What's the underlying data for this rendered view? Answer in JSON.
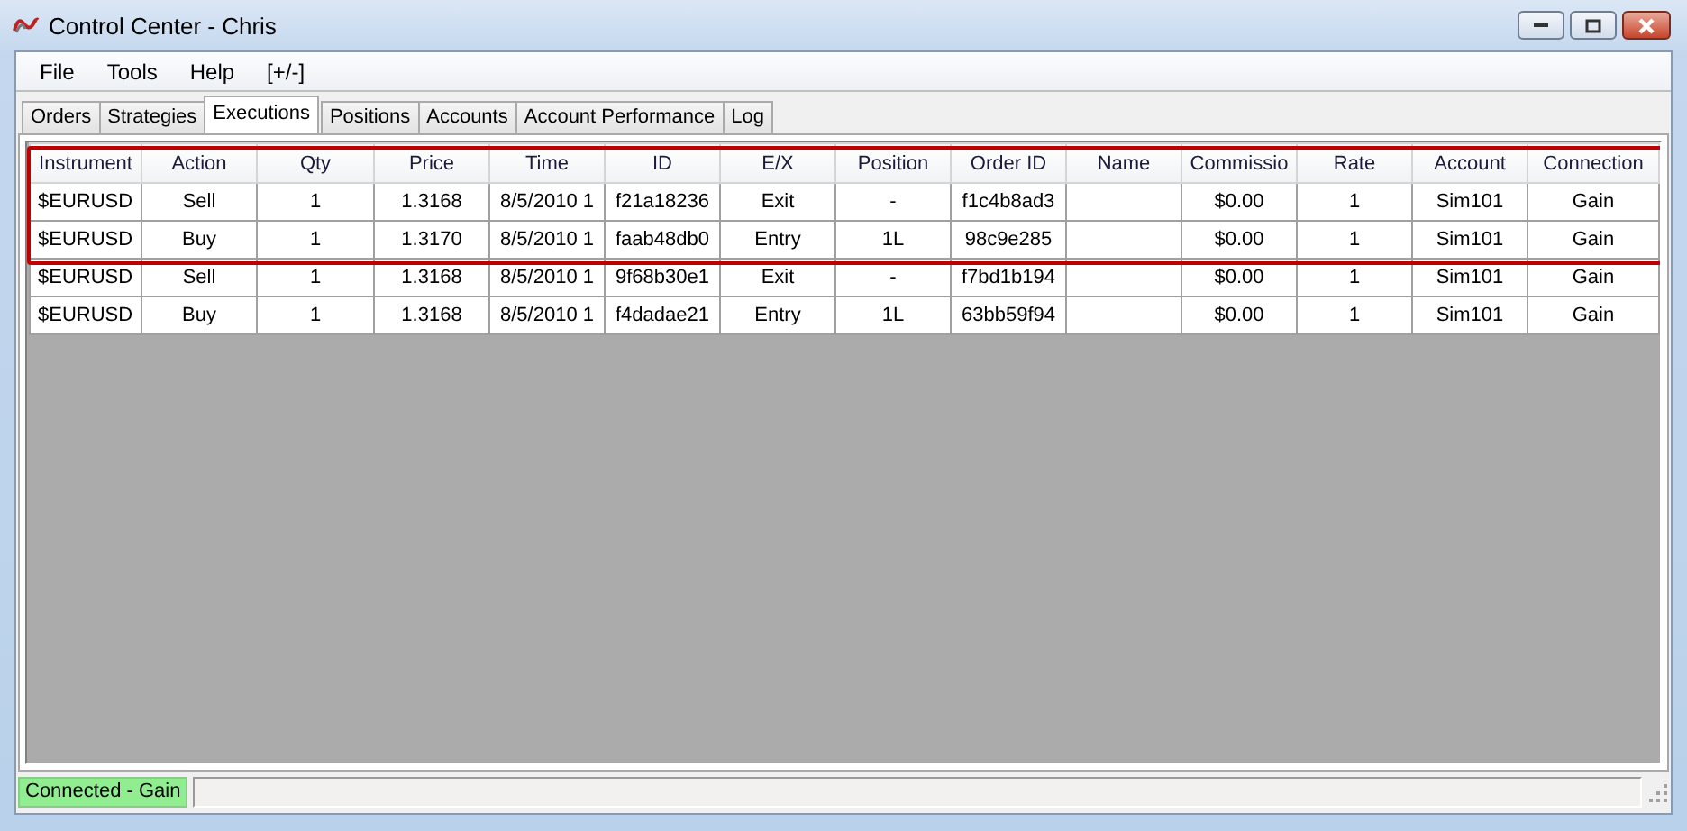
{
  "window": {
    "title": "Control Center - Chris"
  },
  "menu": [
    "File",
    "Tools",
    "Help",
    "[+/-]"
  ],
  "tabs": [
    {
      "label": "Orders",
      "selected": false
    },
    {
      "label": "Strategies",
      "selected": false
    },
    {
      "label": "Executions",
      "selected": true
    },
    {
      "label": "Positions",
      "selected": false
    },
    {
      "label": "Accounts",
      "selected": false
    },
    {
      "label": "Account Performance",
      "selected": false
    },
    {
      "label": "Log",
      "selected": false
    }
  ],
  "table": {
    "columns": [
      "Instrument",
      "Action",
      "Qty",
      "Price",
      "Time",
      "ID",
      "E/X",
      "Position",
      "Order ID",
      "Name",
      "Commissio",
      "Rate",
      "Account",
      "Connection"
    ],
    "rows": [
      {
        "highlighted": true,
        "instrument": "$EURUSD",
        "action": "Sell",
        "qty": "1",
        "price": "1.3168",
        "time": "8/5/2010 1",
        "id": "f21a18236",
        "ex": "Exit",
        "position": "-",
        "order_id": "f1c4b8ad3",
        "commission": "$0.00",
        "rate": "1",
        "account": "Sim101",
        "connection": "Gain"
      },
      {
        "highlighted": true,
        "instrument": "$EURUSD",
        "action": "Buy",
        "qty": "1",
        "price": "1.3170",
        "time": "8/5/2010 1",
        "id": "faab48db0",
        "ex": "Entry",
        "position": "1L",
        "order_id": "98c9e285",
        "commission": "$0.00",
        "rate": "1",
        "account": "Sim101",
        "connection": "Gain"
      },
      {
        "highlighted": false,
        "instrument": "$EURUSD",
        "action": "Sell",
        "qty": "1",
        "price": "1.3168",
        "time": "8/5/2010 1",
        "id": "9f68b30e1",
        "ex": "Exit",
        "position": "-",
        "order_id": "f7bd1b194",
        "commission": "$0.00",
        "rate": "1",
        "account": "Sim101",
        "connection": "Gain"
      },
      {
        "highlighted": false,
        "instrument": "$EURUSD",
        "action": "Buy",
        "qty": "1",
        "price": "1.3168",
        "time": "8/5/2010 1",
        "id": "f4dadae21",
        "ex": "Entry",
        "position": "1L",
        "order_id": "63bb59f94",
        "commission": "$0.00",
        "rate": "1",
        "account": "Sim101",
        "connection": "Gain"
      }
    ]
  },
  "status_bar": {
    "connection": {
      "text": "Connected - Gain",
      "color": "#90ee90"
    }
  }
}
